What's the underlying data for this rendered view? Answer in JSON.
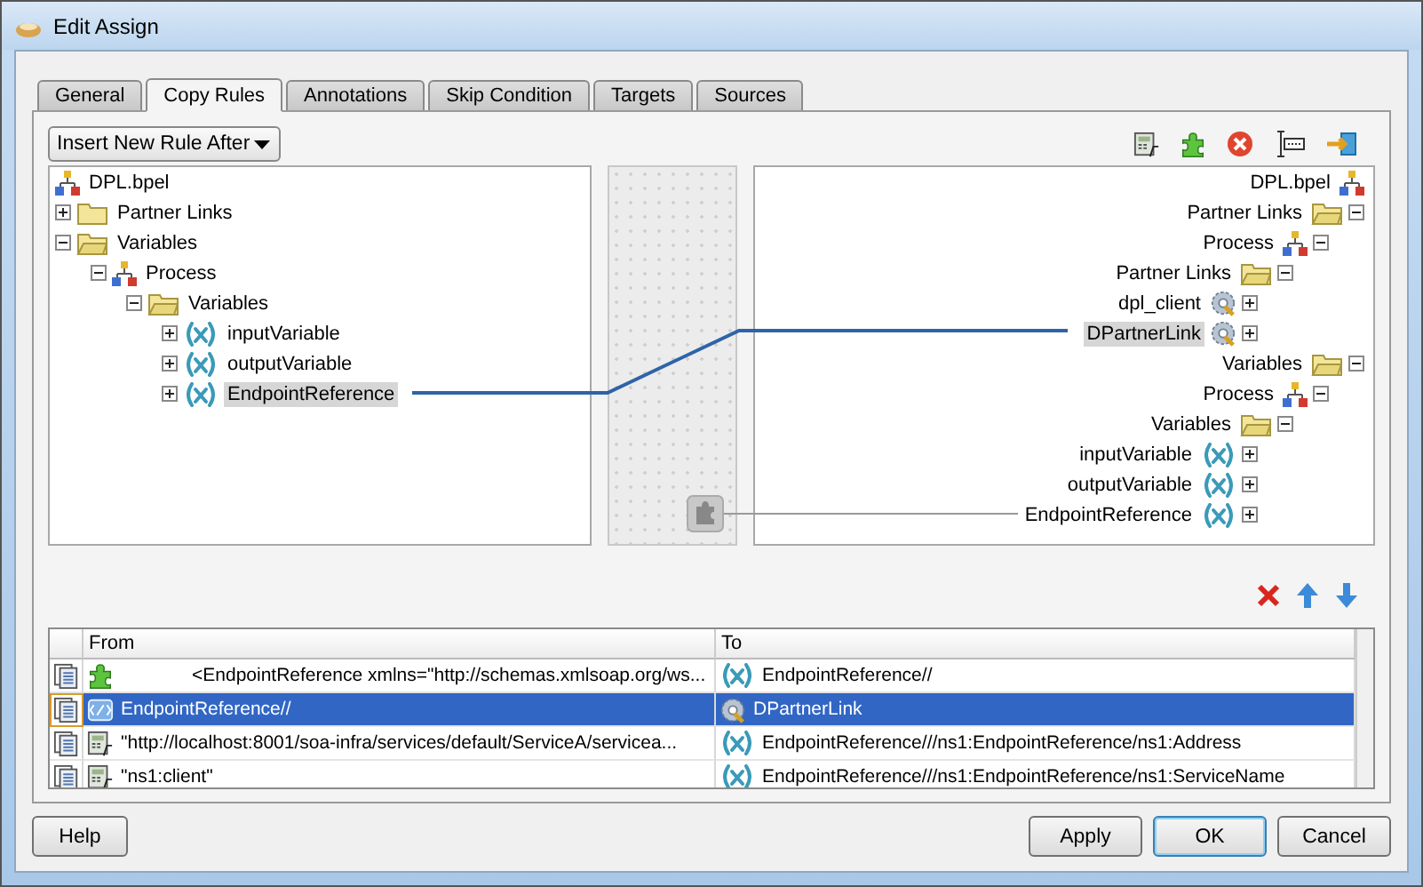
{
  "window": {
    "title": "Edit Assign"
  },
  "tabs": [
    {
      "label": "General",
      "selected": false
    },
    {
      "label": "Copy Rules",
      "selected": true
    },
    {
      "label": "Annotations",
      "selected": false
    },
    {
      "label": "Skip Condition",
      "selected": false
    },
    {
      "label": "Targets",
      "selected": false
    },
    {
      "label": "Sources",
      "selected": false
    }
  ],
  "insert_mode": {
    "value": "Insert New Rule After"
  },
  "source_tree": [
    {
      "label": "DPL.bpel",
      "kind": "process",
      "selected": false
    },
    {
      "label": "Partner Links",
      "kind": "folder",
      "expanded": false,
      "selected": false
    },
    {
      "label": "Variables",
      "kind": "folder",
      "expanded": true,
      "selected": false,
      "children": [
        {
          "label": "Process",
          "kind": "process",
          "expanded": true,
          "selected": false,
          "children": [
            {
              "label": "Variables",
              "kind": "folder",
              "expanded": true,
              "selected": false,
              "children": [
                {
                  "label": "inputVariable",
                  "kind": "variable",
                  "expanded": false,
                  "selected": false
                },
                {
                  "label": "outputVariable",
                  "kind": "variable",
                  "expanded": false,
                  "selected": false
                },
                {
                  "label": "EndpointReference",
                  "kind": "variable",
                  "expanded": false,
                  "selected": true
                }
              ]
            }
          ]
        }
      ]
    }
  ],
  "target_tree": [
    {
      "label": "DPL.bpel",
      "kind": "process",
      "selected": false
    },
    {
      "label": "Partner Links",
      "kind": "folder",
      "expanded": true,
      "selected": false,
      "children": [
        {
          "label": "Process",
          "kind": "process",
          "expanded": true,
          "selected": false,
          "children": [
            {
              "label": "Partner Links",
              "kind": "folder",
              "expanded": true,
              "selected": false,
              "children": [
                {
                  "label": "dpl_client",
                  "kind": "partner-link",
                  "expanded": false,
                  "selected": false
                },
                {
                  "label": "DPartnerLink",
                  "kind": "partner-link",
                  "expanded": false,
                  "selected": true
                }
              ]
            }
          ]
        }
      ]
    },
    {
      "label": "Variables",
      "kind": "folder",
      "expanded": true,
      "selected": false,
      "children": [
        {
          "label": "Process",
          "kind": "process",
          "expanded": true,
          "selected": false,
          "children": [
            {
              "label": "Variables",
              "kind": "folder",
              "expanded": true,
              "selected": false,
              "children": [
                {
                  "label": "inputVariable",
                  "kind": "variable",
                  "expanded": false,
                  "selected": false
                },
                {
                  "label": "outputVariable",
                  "kind": "variable",
                  "expanded": false,
                  "selected": false
                },
                {
                  "label": "EndpointReference",
                  "kind": "variable",
                  "expanded": false,
                  "selected": false
                }
              ]
            }
          ]
        }
      ]
    }
  ],
  "copy_rules": {
    "columns": [
      "From",
      "To"
    ],
    "rows": [
      {
        "from": {
          "text": "<EndpointReference xmlns=\"http://schemas.xmlsoap.org/ws...",
          "kind": "literal"
        },
        "to": {
          "text": "EndpointReference//",
          "kind": "variable"
        },
        "selected": false
      },
      {
        "from": {
          "text": "EndpointReference//",
          "kind": "xml"
        },
        "to": {
          "text": "DPartnerLink",
          "kind": "partner-link"
        },
        "selected": true
      },
      {
        "from": {
          "text": "\"http://localhost:8001/soa-infra/services/default/ServiceA/servicea...",
          "kind": "expression"
        },
        "to": {
          "text": "EndpointReference///ns1:EndpointReference/ns1:Address",
          "kind": "variable"
        },
        "selected": false
      },
      {
        "from": {
          "text": "\"ns1:client\"",
          "kind": "expression"
        },
        "to": {
          "text": "EndpointReference///ns1:EndpointReference/ns1:ServiceName",
          "kind": "variable"
        },
        "selected": false
      }
    ]
  },
  "help_button": {
    "label": "Help"
  },
  "buttons": [
    {
      "label": "Apply",
      "default": false
    },
    {
      "label": "OK",
      "default": true
    },
    {
      "label": "Cancel",
      "default": false
    }
  ]
}
